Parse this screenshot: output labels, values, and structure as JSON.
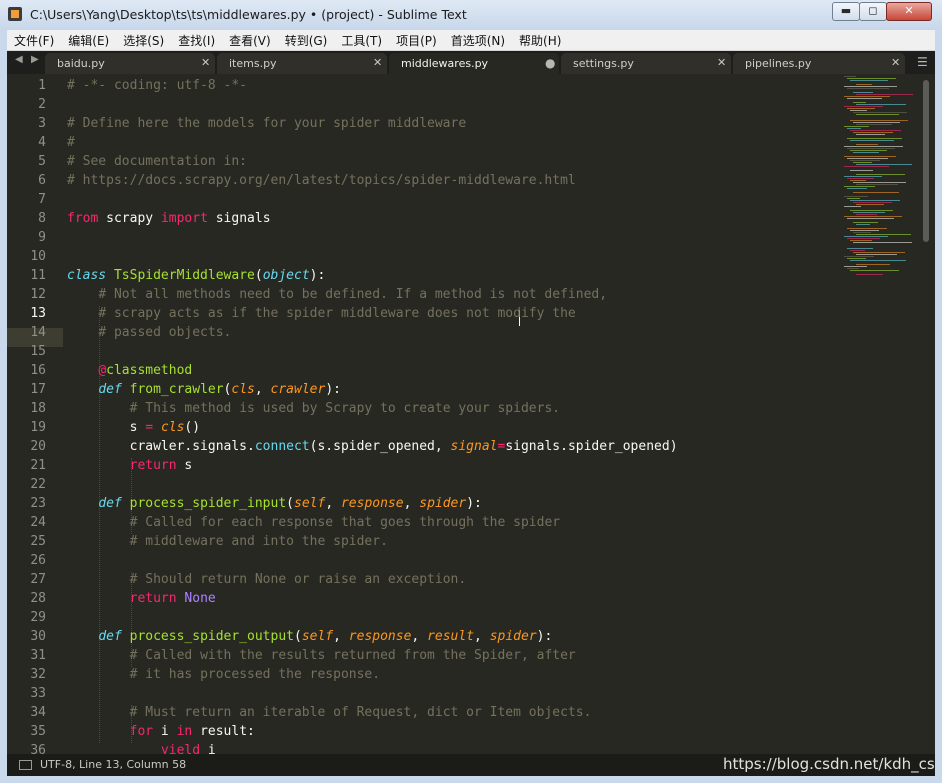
{
  "window": {
    "title": "C:\\Users\\Yang\\Desktop\\ts\\ts\\middlewares.py • (project) - Sublime Text",
    "buttons": {
      "minimize": "▬",
      "maximize": "◻",
      "close": "✕"
    }
  },
  "menubar": {
    "items": [
      "文件(F)",
      "编辑(E)",
      "选择(S)",
      "查找(I)",
      "查看(V)",
      "转到(G)",
      "工具(T)",
      "项目(P)",
      "首选项(N)",
      "帮助(H)"
    ]
  },
  "tabs": {
    "nav_prev": "◀",
    "nav_next": "▶",
    "items": [
      {
        "label": "baidu.py",
        "active": false,
        "close": "✕"
      },
      {
        "label": "items.py",
        "active": false,
        "close": "✕"
      },
      {
        "label": "middlewares.py",
        "active": true,
        "dirty": "●"
      },
      {
        "label": "settings.py",
        "active": false,
        "close": "✕"
      },
      {
        "label": "pipelines.py",
        "active": false,
        "close": "✕"
      }
    ],
    "menu_glyph": "☰"
  },
  "editor": {
    "active_line": 13,
    "line_numbers": [
      "1",
      "2",
      "3",
      "4",
      "5",
      "6",
      "7",
      "8",
      "9",
      "10",
      "11",
      "12",
      "13",
      "14",
      "15",
      "16",
      "17",
      "18",
      "19",
      "20",
      "21",
      "22",
      "23",
      "24",
      "25",
      "26",
      "27",
      "28",
      "29",
      "30",
      "31",
      "32",
      "33",
      "34",
      "35",
      "36"
    ],
    "colors": {
      "background": "#272822",
      "comment": "#75715e",
      "keyword": "#f92672",
      "function": "#a6e22e",
      "storage": "#66d9ef",
      "parameter": "#fd971f",
      "constant": "#ae81ff"
    }
  },
  "statusbar": {
    "text": "UTF-8, Line 13, Column 58",
    "watermark": "https://blog.csdn.net/kdh_csdn"
  }
}
